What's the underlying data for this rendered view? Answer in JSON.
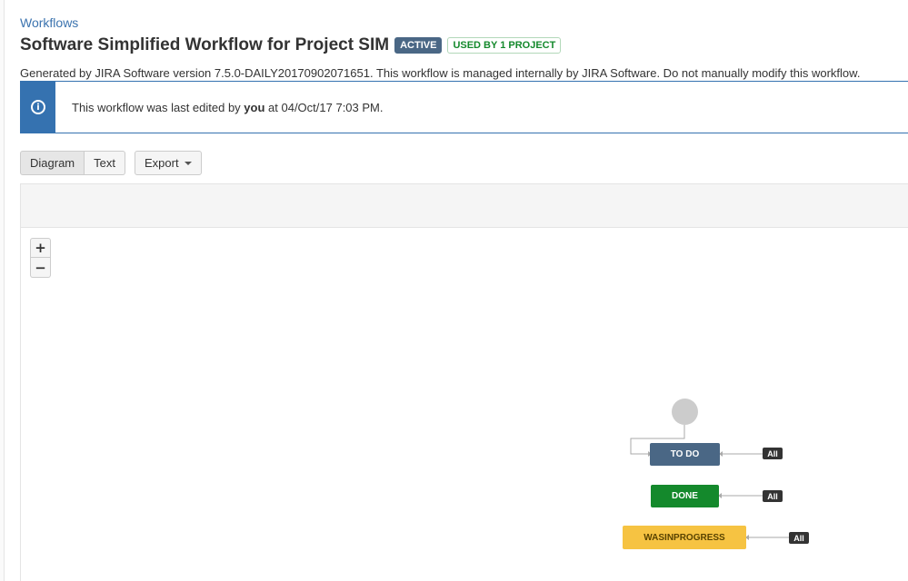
{
  "breadcrumb": {
    "label": "Workflows"
  },
  "header": {
    "title": "Software Simplified Workflow for Project SIM",
    "badge_active": "ACTIVE",
    "badge_used": "USED BY 1 PROJECT"
  },
  "description": "Generated by JIRA Software version 7.5.0-DAILY20170902071651. This workflow is managed internally by JIRA Software. Do not manually modify this workflow.",
  "info_message": {
    "icon": "info-icon",
    "prefix": "This workflow was last edited by ",
    "user": "you",
    "suffix": " at 04/Oct/17 7:03 PM."
  },
  "view_toggle": {
    "diagram": "Diagram",
    "text": "Text"
  },
  "export": {
    "label": "Export"
  },
  "zoom": {
    "in": "+",
    "out": "−"
  },
  "statuses": [
    {
      "name": "TO DO",
      "color": "#4a6785",
      "transition": "All"
    },
    {
      "name": "DONE",
      "color": "#14892c",
      "transition": "All"
    },
    {
      "name": "WASINPROGRESS",
      "color": "#f6c342",
      "transition": "All"
    }
  ],
  "colors": {
    "link": "#3b73af",
    "info": "#3572b0"
  }
}
